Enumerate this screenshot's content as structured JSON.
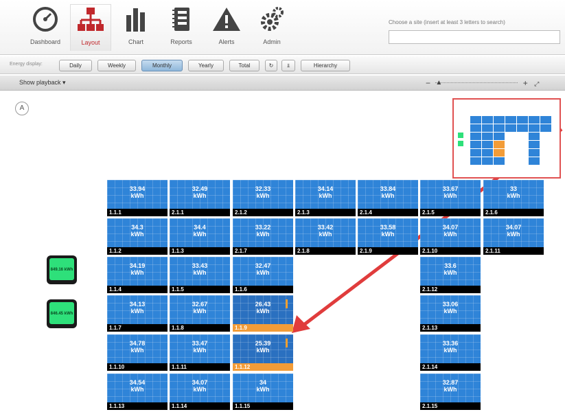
{
  "nav": {
    "items": [
      {
        "label": "Dashboard",
        "icon": "speedometer-icon"
      },
      {
        "label": "Layout",
        "icon": "hierarchy-icon"
      },
      {
        "label": "Chart",
        "icon": "bar-chart-icon"
      },
      {
        "label": "Reports",
        "icon": "notebook-icon"
      },
      {
        "label": "Alerts",
        "icon": "warning-icon"
      },
      {
        "label": "Admin",
        "icon": "gears-icon"
      }
    ],
    "active": "Layout"
  },
  "site_search": {
    "label": "Choose a site (insert at least 3 letters to search)",
    "value": ""
  },
  "toolbar": {
    "energy_label": "Energy display:",
    "buttons": [
      "Daily",
      "Weekly",
      "Monthly",
      "Yearly",
      "Total"
    ],
    "active": "Monthly",
    "hierarchy_label": "Hierarchy"
  },
  "playback": {
    "label": "Show playback ▾"
  },
  "panels": [
    {
      "value": "33.94",
      "unit": "kWh",
      "id": "1.1.1"
    },
    {
      "value": "32.49",
      "unit": "kWh",
      "id": "2.1.1"
    },
    {
      "value": "32.33",
      "unit": "kWh",
      "id": "2.1.2"
    },
    {
      "value": "34.14",
      "unit": "kWh",
      "id": "2.1.3"
    },
    {
      "value": "33.84",
      "unit": "kWh",
      "id": "2.1.4"
    },
    {
      "value": "33.67",
      "unit": "kWh",
      "id": "2.1.5"
    },
    {
      "value": "33",
      "unit": "kWh",
      "id": "2.1.6"
    },
    {
      "value": "34.3",
      "unit": "kWh",
      "id": "1.1.2"
    },
    {
      "value": "34.4",
      "unit": "kWh",
      "id": "1.1.3"
    },
    {
      "value": "33.22",
      "unit": "kWh",
      "id": "2.1.7"
    },
    {
      "value": "33.42",
      "unit": "kWh",
      "id": "2.1.8"
    },
    {
      "value": "33.58",
      "unit": "kWh",
      "id": "2.1.9"
    },
    {
      "value": "34.07",
      "unit": "kWh",
      "id": "2.1.10"
    },
    {
      "value": "34.07",
      "unit": "kWh",
      "id": "2.1.11"
    },
    {
      "value": "34.19",
      "unit": "kWh",
      "id": "1.1.4"
    },
    {
      "value": "33.43",
      "unit": "kWh",
      "id": "1.1.5"
    },
    {
      "value": "32.47",
      "unit": "kWh",
      "id": "1.1.6"
    },
    {
      "value": "33.6",
      "unit": "kWh",
      "id": "2.1.12"
    },
    {
      "value": "34.13",
      "unit": "kWh",
      "id": "1.1.7"
    },
    {
      "value": "32.67",
      "unit": "kWh",
      "id": "1.1.8"
    },
    {
      "value": "26.43",
      "unit": "kWh",
      "id": "1.1.9",
      "alert": true
    },
    {
      "value": "33.06",
      "unit": "kWh",
      "id": "2.1.13"
    },
    {
      "value": "34.78",
      "unit": "kWh",
      "id": "1.1.10"
    },
    {
      "value": "33.47",
      "unit": "kWh",
      "id": "1.1.11"
    },
    {
      "value": "25.39",
      "unit": "kWh",
      "id": "1.1.12",
      "alert": true
    },
    {
      "value": "33.36",
      "unit": "kWh",
      "id": "2.1.14"
    },
    {
      "value": "34.54",
      "unit": "kWh",
      "id": "1.1.13"
    },
    {
      "value": "34.07",
      "unit": "kWh",
      "id": "1.1.14"
    },
    {
      "value": "34",
      "unit": "kWh",
      "id": "1.1.15"
    },
    {
      "value": "32.87",
      "unit": "kWh",
      "id": "2.1.15"
    }
  ],
  "inverters": [
    {
      "value": "849.16",
      "unit": "kWh"
    },
    {
      "value": "846.45",
      "unit": "kWh"
    }
  ],
  "colors": {
    "panel": "#2f84d8",
    "alert": "#f29c38",
    "inverter": "#2ee07a",
    "arrow": "#e03c3c"
  }
}
